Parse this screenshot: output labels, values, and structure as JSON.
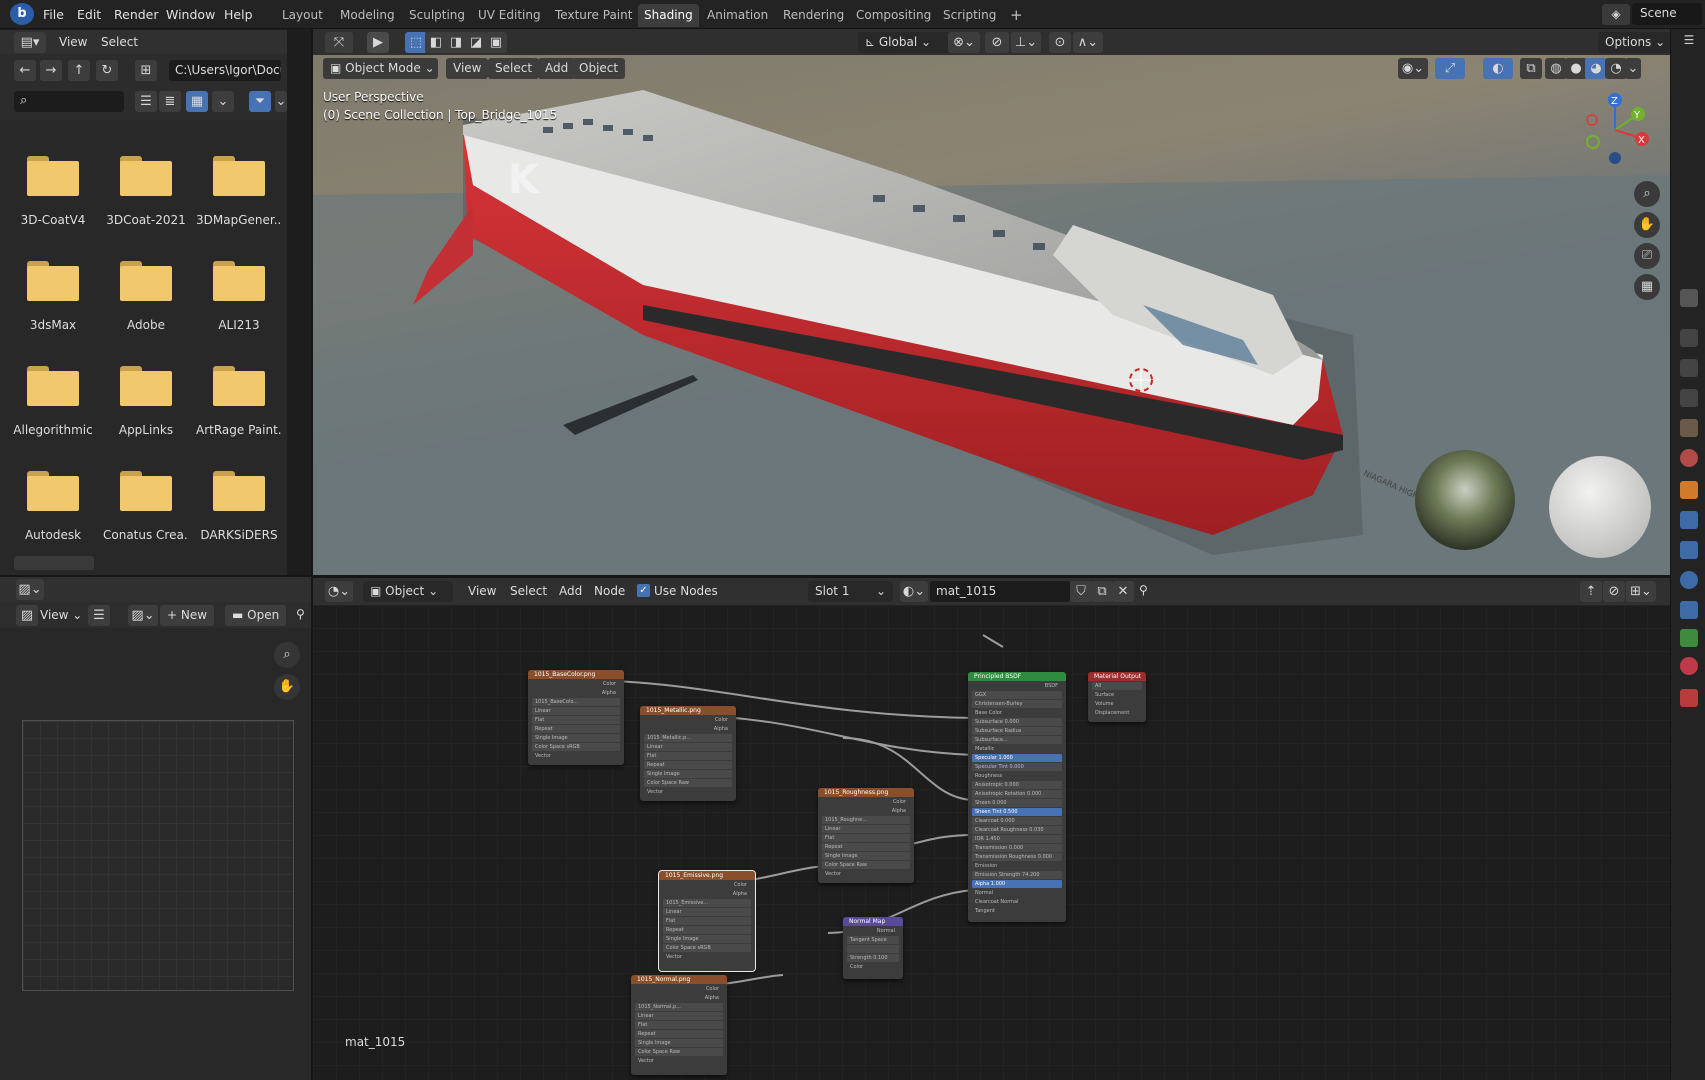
{
  "topbar": {
    "menus": [
      "File",
      "Edit",
      "Render",
      "Window",
      "Help"
    ],
    "workspaces": [
      "Layout",
      "Modeling",
      "Sculpting",
      "UV Editing",
      "Texture Paint",
      "Shading",
      "Animation",
      "Rendering",
      "Compositing",
      "Scripting"
    ],
    "active_workspace": "Shading",
    "add_tab": "+",
    "scene": "Scene"
  },
  "filebrowser": {
    "menus": [
      "View",
      "Select"
    ],
    "path": "C:\\Users\\Igor\\Docume...",
    "folders": [
      "3D-CoatV4",
      "3DCoat-2021",
      "3DMapGener...",
      "3dsMax",
      "Adobe",
      "ALI213",
      "Allegorithmic",
      "AppLinks",
      "ArtRage Paint...",
      "Autodesk",
      "Conatus Crea...",
      "DARKSiDERS"
    ]
  },
  "viewport": {
    "toolbar": {
      "orientation": "Global",
      "options": "Options"
    },
    "mode": "Object Mode",
    "menus": [
      "View",
      "Select",
      "Add",
      "Object"
    ],
    "info_line1": "User Perspective",
    "info_line2": "(0) Scene Collection | Top_Bridge_1015",
    "ship_hull_letter": "K",
    "ship_name": "NIAGARA HIGHWAY",
    "gizmo": {
      "z": "Z",
      "y": "Y",
      "x": "X"
    }
  },
  "imgeditor": {
    "view": "View",
    "new": "New",
    "open": "Open"
  },
  "nodeeditor": {
    "type": "Object",
    "menus": [
      "View",
      "Select",
      "Add",
      "Node"
    ],
    "use_nodes": "Use Nodes",
    "slot": "Slot 1",
    "material": "mat_1015",
    "footer_label": "mat_1015"
  },
  "nodes": {
    "basecolor": "1015_BaseColor.png",
    "metallic": "1015_Metallic.png",
    "roughness": "1015_Roughness.png",
    "emissive": "1015_Emissive.png",
    "normal": "1015_Normal.png",
    "normalmap": "Normal Map",
    "bsdf": "Principled BSDF",
    "output": "Material Output"
  },
  "colors": {
    "accent": "#4772b3",
    "active_tab": "#3d3d3d",
    "folder": "#f1c86b",
    "hull_red": "#c8262a"
  }
}
